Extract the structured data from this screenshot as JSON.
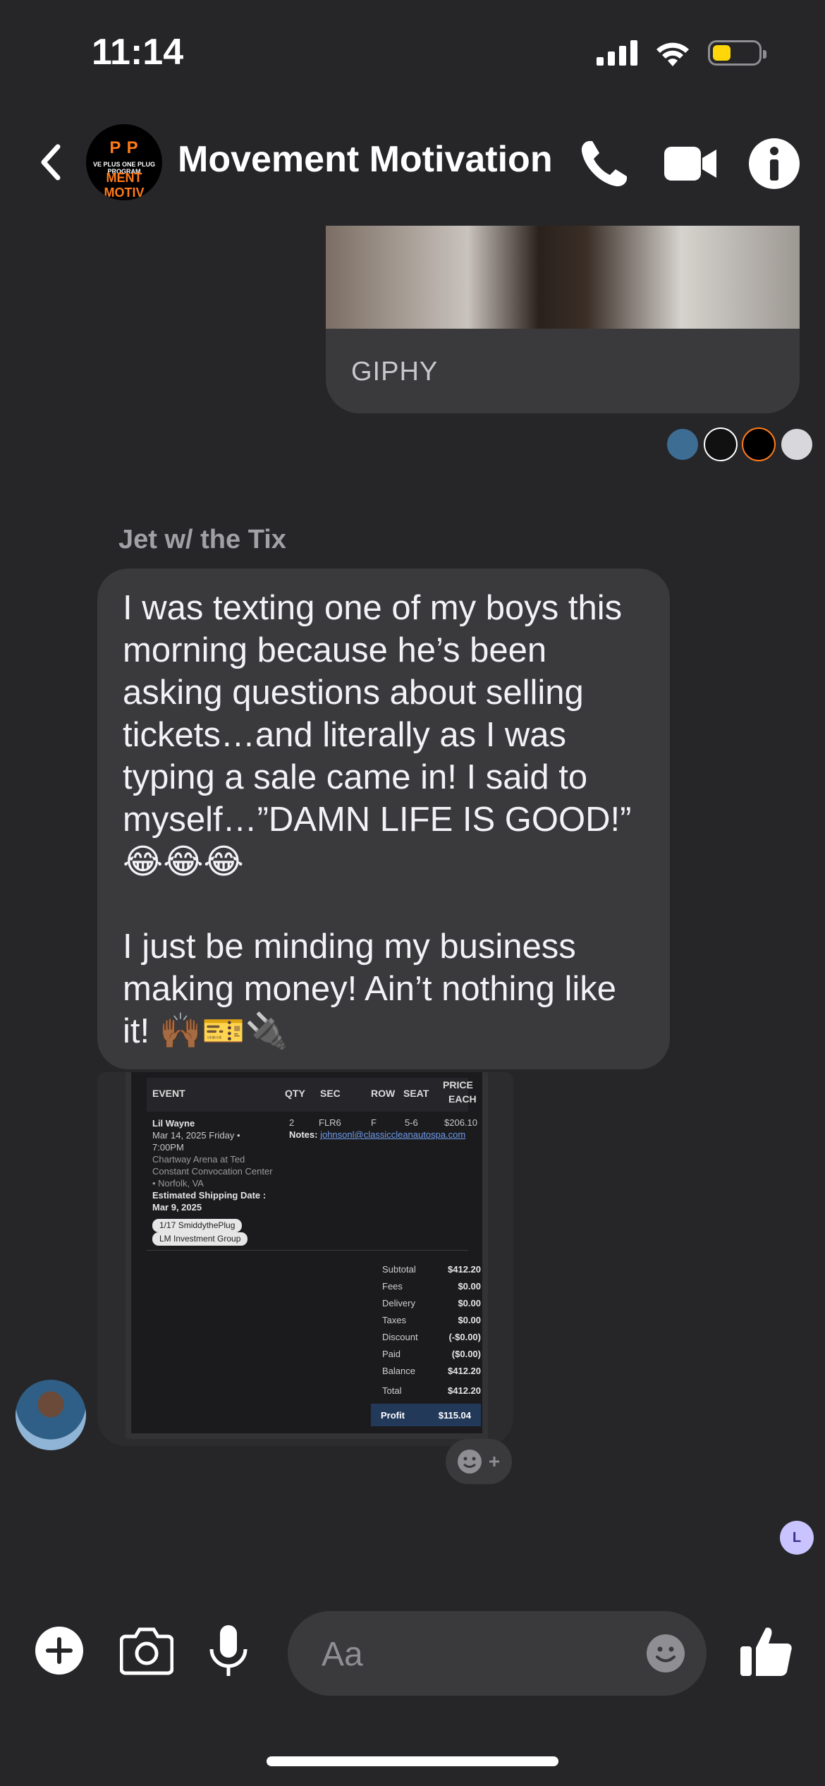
{
  "status_bar": {
    "time": "11:14"
  },
  "header": {
    "title": "Movement Motivation",
    "avatar_text_top": "P P",
    "avatar_text_mid": "VE PLUS ONE PLUG PROGRAM",
    "avatar_text_bottom": "MENT MOTIV"
  },
  "messages": {
    "giphy_label": "GIPHY",
    "sender_name": "Jet w/ the Tix",
    "text": "I was texting one of my boys this morning because he’s been asking questions about selling tickets…and literally as I was typing a sale came in! I said to myself…”DAMN LIFE IS GOOD!” 😂😂😂\n\nI just be minding my business making money! Ain’t nothing like it! 🙌🏾🎫🔌"
  },
  "receipt": {
    "headers": {
      "event": "EVENT",
      "qty": "QTY",
      "sec": "SEC",
      "row": "ROW",
      "seat": "SEAT",
      "price": "PRICE",
      "each": "EACH"
    },
    "event_name": "Lil Wayne",
    "event_date": "Mar 14, 2025 Friday •",
    "event_time": "7:00PM",
    "venue_1": "Chartway Arena at Ted",
    "venue_2": "Constant Convocation Center",
    "venue_3": "• Norfolk, VA",
    "ship_label": "Estimated Shipping Date :",
    "ship_date": "Mar 9, 2025",
    "qty": "2",
    "sec": "FLR6",
    "row": "F",
    "seat": "5-6",
    "price": "$206.10",
    "notes_label": "Notes:",
    "notes_email": "johnsonl@classiccleanautospa.com",
    "tag_1": "1/17 SmiddythePlug",
    "tag_2": "LM Investment Group",
    "totals": [
      {
        "label": "Subtotal",
        "value": "$412.20"
      },
      {
        "label": "Fees",
        "value": "$0.00"
      },
      {
        "label": "Delivery",
        "value": "$0.00"
      },
      {
        "label": "Taxes",
        "value": "$0.00"
      },
      {
        "label": "Discount",
        "value": "(-$0.00)"
      },
      {
        "label": "Paid",
        "value": "($0.00)"
      },
      {
        "label": "Balance",
        "value": "$412.20"
      },
      {
        "label": "Total",
        "value": "$412.20"
      }
    ],
    "profit_label": "Profit",
    "profit_value": "$115.04"
  },
  "read_receipt_letter": "L",
  "composer": {
    "placeholder": "Aa"
  },
  "colors": {
    "background": "#262629",
    "bubble": "#3a3a3c",
    "battery": "#ffd60a"
  }
}
